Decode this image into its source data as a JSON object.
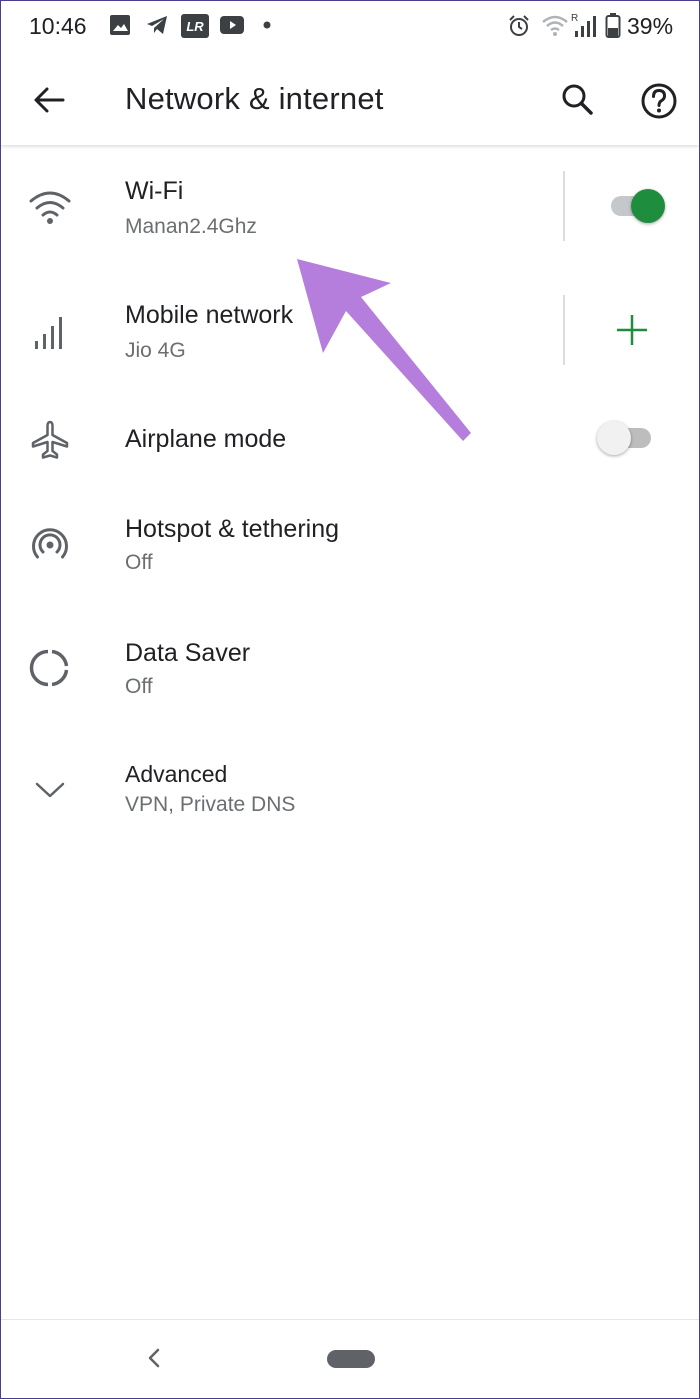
{
  "status_bar": {
    "time": "10:46",
    "battery": "39%",
    "icons": [
      "gallery-icon",
      "telegram-icon",
      "lightroom-icon",
      "youtube-icon",
      "notification-dot-icon",
      "alarm-icon",
      "wifi-signal-icon",
      "cell-signal-roaming-icon",
      "battery-icon"
    ],
    "lightroom_text": "LR",
    "roaming_text": "R"
  },
  "app_bar": {
    "title": "Network & internet",
    "back_icon": "arrow-back-icon",
    "search_icon": "search-icon",
    "help_icon": "help-icon"
  },
  "settings": {
    "wifi": {
      "title": "Wi-Fi",
      "subtitle": "Manan2.4Ghz",
      "icon": "wifi-icon",
      "enabled": true
    },
    "mobile": {
      "title": "Mobile network",
      "subtitle": "Jio 4G",
      "icon": "cell-signal-icon",
      "action_icon": "plus-icon"
    },
    "airplane": {
      "title": "Airplane mode",
      "icon": "airplane-icon",
      "enabled": false
    },
    "hotspot": {
      "title": "Hotspot & tethering",
      "subtitle": "Off",
      "icon": "hotspot-icon"
    },
    "data_saver": {
      "title": "Data Saver",
      "subtitle": "Off",
      "icon": "data-saver-icon"
    },
    "advanced": {
      "title": "Advanced",
      "subtitle": "VPN, Private DNS",
      "icon": "chevron-down-icon"
    }
  },
  "colors": {
    "switch_on_track": "#c5c8cb",
    "switch_on_thumb": "#1e8e3e",
    "switch_off_track": "#bdbdbd",
    "switch_off_thumb": "#f1f1f1",
    "plus": "#1e8e3e",
    "annotation_arrow": "#b57edc",
    "icon_grey": "#5f6368"
  },
  "nav_bar": {
    "back_icon": "nav-back-icon",
    "home_icon": "nav-home-pill"
  }
}
